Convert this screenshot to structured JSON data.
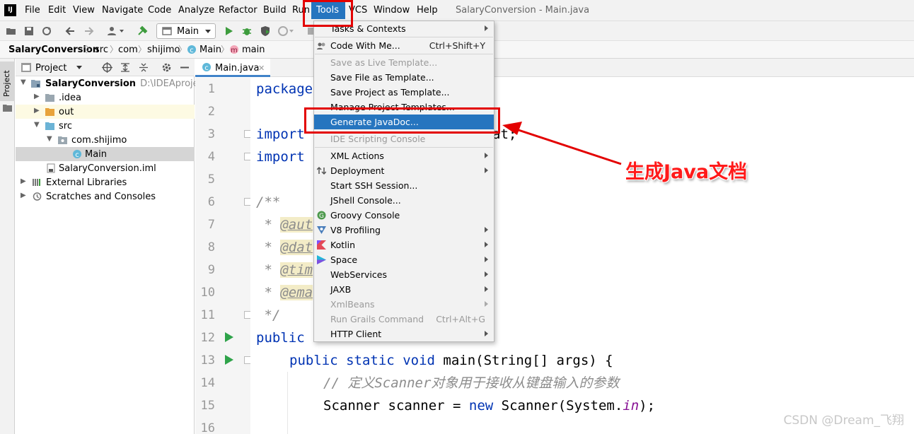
{
  "app": {
    "logo_text": "IJ",
    "window_title": "SalaryConversion - Main.java"
  },
  "menubar": {
    "items": [
      "File",
      "Edit",
      "View",
      "Navigate",
      "Code",
      "Analyze",
      "Refactor",
      "Build",
      "Run",
      "Tools",
      "VCS",
      "Window",
      "Help"
    ]
  },
  "toolbar": {
    "run_config": "Main"
  },
  "breadcrumb": {
    "items": [
      "SalaryConversion",
      "src",
      "com",
      "shijimo",
      "Main",
      "main"
    ]
  },
  "left_strip": {
    "project_label": "Project"
  },
  "project_panel": {
    "header_label": "Project",
    "tree": [
      {
        "label": "SalaryConversion",
        "path": "D:\\IDEAproject\\S",
        "bold": true
      },
      {
        "label": ".idea"
      },
      {
        "label": "out"
      },
      {
        "label": "src"
      },
      {
        "label": "com.shijimo"
      },
      {
        "label": "Main"
      },
      {
        "label": "SalaryConversion.iml"
      },
      {
        "label": "External Libraries"
      },
      {
        "label": "Scratches and Consoles"
      }
    ]
  },
  "editor": {
    "tab_label": "Main.java",
    "line_numbers": [
      "1",
      "2",
      "3",
      "4",
      "5",
      "6",
      "7",
      "8",
      "9",
      "10",
      "11",
      "12",
      "13",
      "14",
      "15",
      "16"
    ],
    "code": {
      "l1_kw": "package",
      "l3_kw": "import",
      "l3_tail": "at;",
      "l4_kw": "import",
      "l6": "/**",
      "l7_star": " * ",
      "l7_tag": "@aut",
      "l8_tag": "@dat",
      "l9_tag": "@tim",
      "l10_tag": "@ema",
      "l11": " */",
      "l12_kw": "public",
      "l12_tail": "      {",
      "l13_kw1": "public",
      "l13_kw2": "static",
      "l13_kw3": "void",
      "l13_rest": " main(String[] args) {",
      "l14": "// 定义Scanner对象用于接收从键盘输入的参数",
      "l15_a": "Scanner scanner = ",
      "l15_kw": "new",
      "l15_b": " Scanner(System.",
      "l15_fld": "in",
      "l15_c": ");"
    }
  },
  "tools_menu": {
    "items": [
      {
        "label": "Tasks & Contexts",
        "submenu": true
      },
      {
        "label": "Code With Me...",
        "shortcut": "Ctrl+Shift+Y"
      },
      {
        "label": "Save as Live Template...",
        "disabled": true
      },
      {
        "label": "Save File as Template..."
      },
      {
        "label": "Save Project as Template..."
      },
      {
        "label": "Manage Project Templates..."
      },
      {
        "label": "Generate JavaDoc...",
        "selected": true
      },
      {
        "label": "IDE Scripting Console",
        "disabled": true
      },
      {
        "label": "XML Actions",
        "submenu": true
      },
      {
        "label": "Deployment",
        "submenu": true
      },
      {
        "label": "Start SSH Session..."
      },
      {
        "label": "JShell Console..."
      },
      {
        "label": "Groovy Console"
      },
      {
        "label": "V8 Profiling",
        "submenu": true
      },
      {
        "label": "Kotlin",
        "submenu": true
      },
      {
        "label": "Space",
        "submenu": true
      },
      {
        "label": "WebServices",
        "submenu": true
      },
      {
        "label": "JAXB",
        "submenu": true
      },
      {
        "label": "XmlBeans",
        "submenu": true,
        "disabled": true
      },
      {
        "label": "Run Grails Command",
        "shortcut": "Ctrl+Alt+G",
        "disabled": true
      },
      {
        "label": "HTTP Client",
        "submenu": true
      }
    ]
  },
  "annotation": {
    "label": "生成Java文档",
    "color": "#e30000"
  },
  "watermark": "CSDN @Dream_飞翔"
}
